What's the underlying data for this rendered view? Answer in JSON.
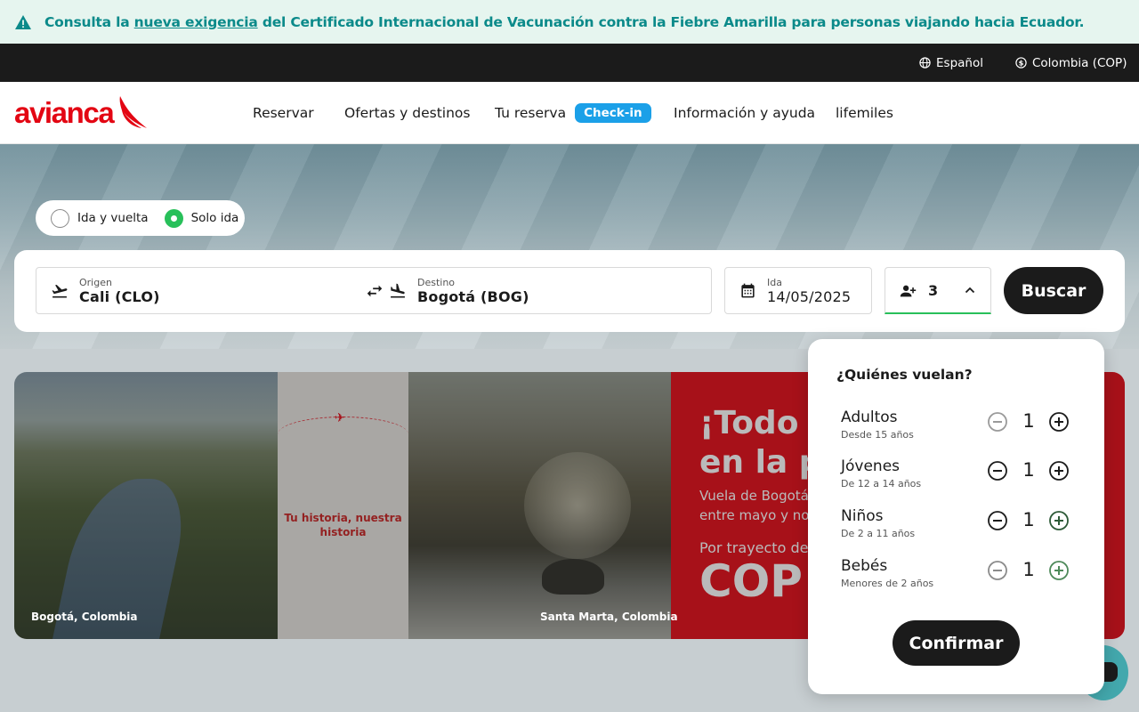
{
  "alert": {
    "text_before": "Consulta la ",
    "link": "nueva exigencia",
    "text_after": " del Certificado Internacional de Vacunación contra la Fiebre Amarilla para personas viajando hacia Ecuador."
  },
  "topbar": {
    "language": "Español",
    "country": "Colombia (COP)"
  },
  "nav": {
    "logo": "avianca",
    "items": [
      "Reservar",
      "Ofertas y destinos",
      "Tu reserva",
      "Información y ayuda",
      "lifemiles"
    ],
    "checkin_badge": "Check-in"
  },
  "trip_type": {
    "round_trip": "Ida y vuelta",
    "one_way": "Solo ida",
    "selected": "one_way"
  },
  "search": {
    "origin_label": "Origen",
    "origin_value": "Cali  (CLO)",
    "destination_label": "Destino",
    "destination_value": "Bogotá  (BOG)",
    "date_label": "Ida",
    "date_value": "14/05/2025",
    "passengers_count": "3",
    "submit": "Buscar"
  },
  "promo": {
    "caption_left": "Bogotá, Colombia",
    "story": "Tu historia, nuestra historia",
    "caption_right": "Santa Marta, Colombia",
    "headline_1": "¡Todo e",
    "headline_2": "en la p",
    "sub_1": "Vuela de Bogotá a",
    "sub_2": "entre mayo y nov",
    "from": "Por trayecto desd",
    "price": "COP"
  },
  "passengers": {
    "title": "¿Quiénes vuelan?",
    "rows": [
      {
        "name": "Adultos",
        "age": "Desde 15 años",
        "count": "1"
      },
      {
        "name": "Jóvenes",
        "age": "De 12 a 14 años",
        "count": "1"
      },
      {
        "name": "Niños",
        "age": "De 2 a 11 años",
        "count": "1"
      },
      {
        "name": "Bebés",
        "age": "Menores de 2 años",
        "count": "1"
      }
    ],
    "confirm": "Confirmar"
  },
  "colors": {
    "brand_red": "#e30613",
    "accent_green": "#28c05a",
    "badge_blue": "#1ba0e8",
    "alert_teal": "#0b8a8a"
  }
}
